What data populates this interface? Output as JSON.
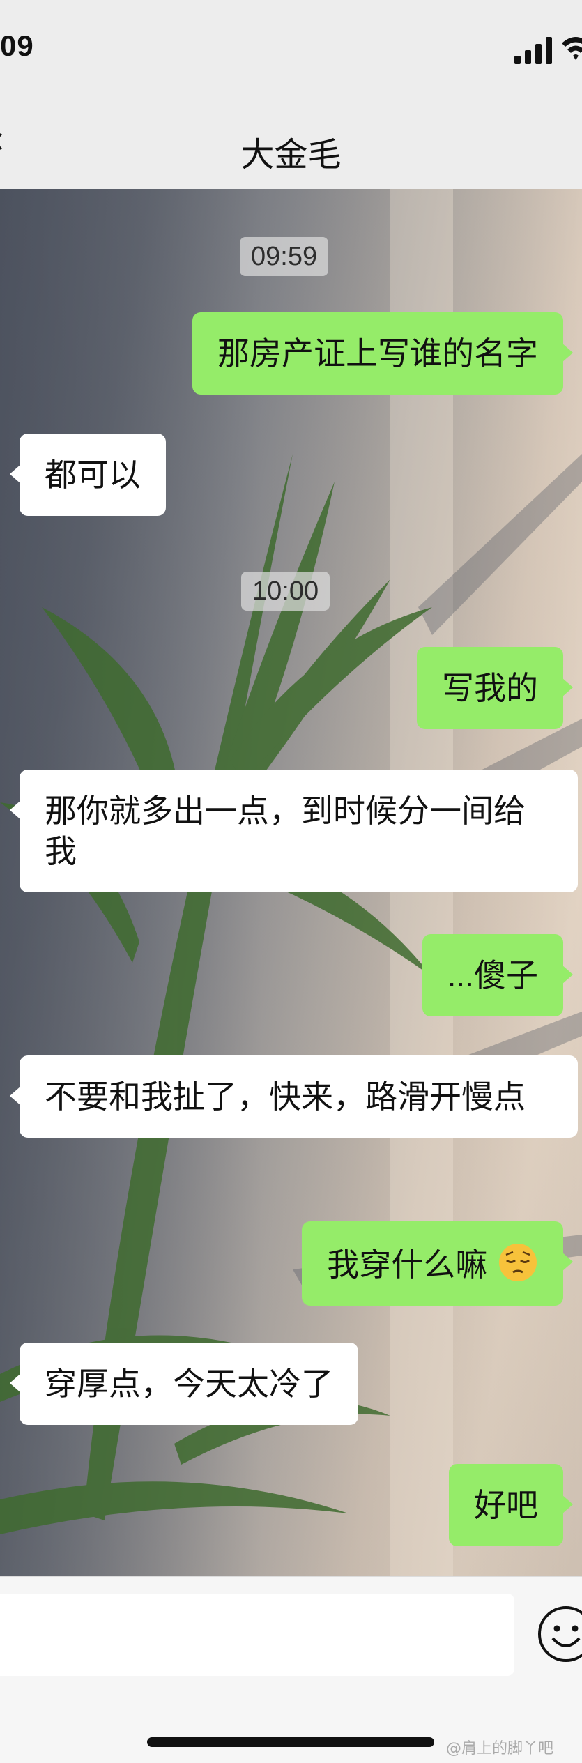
{
  "status_bar": {
    "time": "09",
    "signal_icon": "cellular-signal-icon",
    "wifi_icon": "wifi-icon"
  },
  "nav": {
    "title": "大金毛",
    "back_icon": "back-chevron-icon"
  },
  "chat": {
    "timestamps": [
      "09:59",
      "10:00"
    ],
    "messages": [
      {
        "side": "right",
        "text": "那房产证上写谁的名字"
      },
      {
        "side": "left",
        "text": "都可以"
      },
      {
        "side": "right",
        "text": "写我的"
      },
      {
        "side": "left",
        "text": "那你就多出一点，到时候分一间给我"
      },
      {
        "side": "right",
        "text": "...傻子"
      },
      {
        "side": "left",
        "text": "不要和我扯了，快来，路滑开慢点"
      },
      {
        "side": "right",
        "text": "我穿什么嘛",
        "emoji": "pensive-face-emoji"
      },
      {
        "side": "left",
        "text": "穿厚点，今天太冷了"
      },
      {
        "side": "right",
        "text": "好吧"
      }
    ]
  },
  "input_bar": {
    "input_value": "",
    "emoji_button_icon": "smiley-face-icon"
  },
  "watermark": "@肩上的脚丫吧",
  "colors": {
    "outgoing_bubble": "#95ec69",
    "incoming_bubble": "#ffffff",
    "chrome_background": "#ededed"
  }
}
